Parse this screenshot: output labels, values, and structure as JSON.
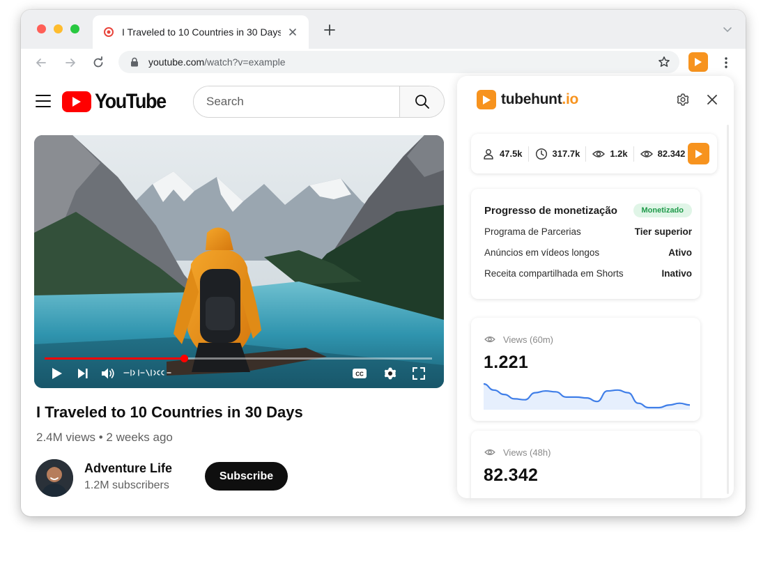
{
  "browser": {
    "tab_title": "I Traveled to 10 Countries in 30 Days",
    "url_domain": "youtube.com",
    "url_path": "/watch?v=example"
  },
  "youtube": {
    "logo_text": "YouTube",
    "search_placeholder": "Search",
    "video": {
      "title": "I Traveled to 10 Countries in 30 Days",
      "meta": "2.4M views • 2 weeks ago",
      "progress": 0.36
    },
    "channel": {
      "name": "Adventure Life",
      "subscribers": "1.2M subscribers"
    },
    "subscribe_label": "Subscribe"
  },
  "extension": {
    "brand_main": "tubehunt",
    "brand_accent": ".io",
    "accent_color": "#f7931e",
    "stats": [
      {
        "icon": "person-icon",
        "value": "47.5k"
      },
      {
        "icon": "clock-icon",
        "value": "317.7k"
      },
      {
        "icon": "eye-icon",
        "value": "1.2k"
      },
      {
        "icon": "eye-icon",
        "value": "82.342"
      }
    ],
    "monetization": {
      "title": "Progresso de monetização",
      "badge": "Monetizado",
      "rows": [
        {
          "label": "Programa de Parcerias",
          "value": "Tier superior"
        },
        {
          "label": "Anúncios em vídeos longos",
          "value": "Ativo"
        },
        {
          "label": "Receita compartilhada em Shorts",
          "value": "Inativo"
        }
      ]
    },
    "views_60m": {
      "label": "Views (60m)",
      "value": "1.221",
      "trend": [
        62,
        55,
        50,
        45,
        44,
        52,
        54,
        53,
        47,
        47,
        46,
        42,
        54,
        55,
        52,
        40,
        35,
        35,
        38,
        40,
        38
      ]
    },
    "views_48h": {
      "label": "Views (48h)",
      "value": "82.342"
    }
  }
}
